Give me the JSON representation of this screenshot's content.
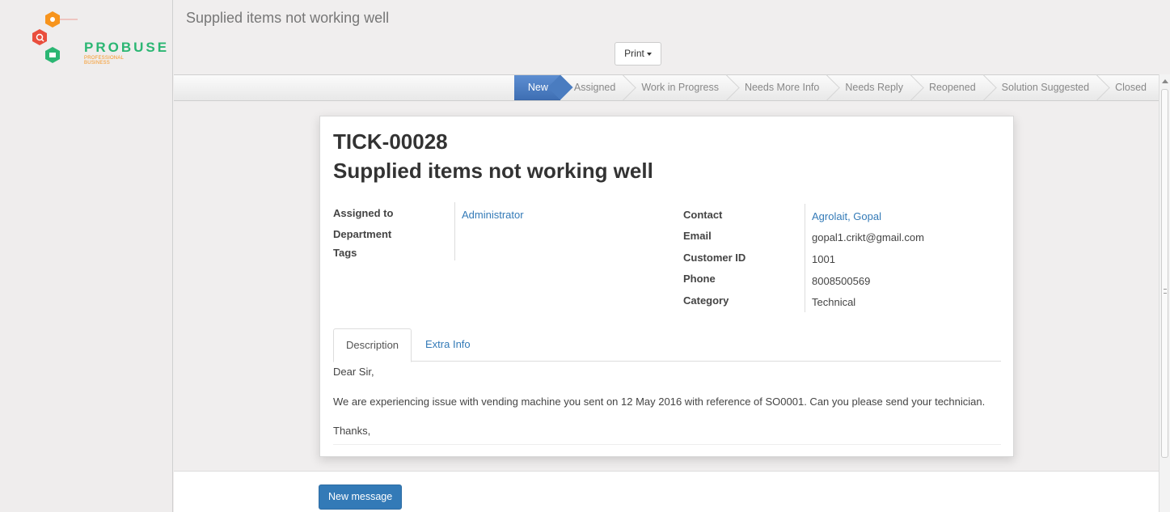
{
  "brand": {
    "name": "PROBUSE",
    "tagline": "PROFESSIONAL BUSINESS"
  },
  "header": {
    "title": "Supplied items not working well",
    "print_label": "Print"
  },
  "statusbar": {
    "stages": [
      {
        "label": "New",
        "active": true
      },
      {
        "label": "Assigned",
        "active": false
      },
      {
        "label": "Work in Progress",
        "active": false
      },
      {
        "label": "Needs More Info",
        "active": false
      },
      {
        "label": "Needs Reply",
        "active": false
      },
      {
        "label": "Reopened",
        "active": false
      },
      {
        "label": "Solution Suggested",
        "active": false
      },
      {
        "label": "Closed",
        "active": false
      }
    ]
  },
  "ticket": {
    "number": "TICK-00028",
    "title": "Supplied items not working well",
    "left_fields": {
      "assigned_to_label": "Assigned to",
      "assigned_to_value": "Administrator",
      "department_label": "Department",
      "tags_label": "Tags"
    },
    "right_fields": {
      "contact_label": "Contact",
      "contact_value": "Agrolait, Gopal",
      "email_label": "Email",
      "email_value": "gopal1.crikt@gmail.com",
      "customer_id_label": "Customer ID",
      "customer_id_value": "1001",
      "phone_label": "Phone",
      "phone_value": "8008500569",
      "category_label": "Category",
      "category_value": "Technical"
    },
    "tabs": {
      "description": "Description",
      "extra_info": "Extra Info"
    },
    "description": {
      "greeting": "Dear Sir,",
      "body": "We are experiencing issue with vending machine you sent on 12 May 2016 with reference of SO0001.  Can you please send your technician.",
      "closing": "Thanks,"
    }
  },
  "chatter": {
    "new_message_label": "New message"
  },
  "colors": {
    "primary": "#337ab7",
    "active_stage": "#4a7cc0",
    "logo_green": "#2bb673",
    "logo_orange": "#f7941d",
    "logo_red": "#e94e3d"
  }
}
